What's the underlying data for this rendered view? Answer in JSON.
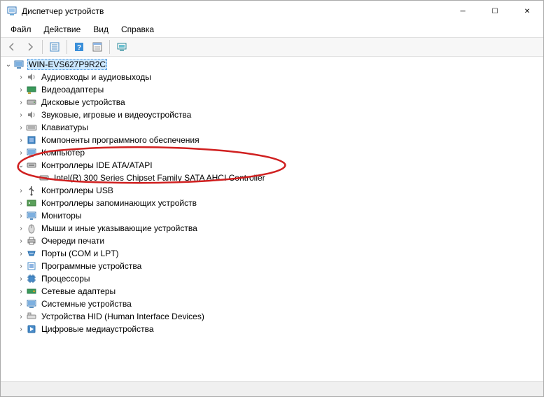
{
  "window": {
    "title": "Диспетчер устройств",
    "minimize": "─",
    "maximize": "☐",
    "close": "✕"
  },
  "menu": {
    "file": "Файл",
    "action": "Действие",
    "view": "Вид",
    "help": "Справка"
  },
  "tree": {
    "root": "WIN-EVS627P9R2C",
    "audio": "Аудиовходы и аудиовыходы",
    "video": "Видеоадаптеры",
    "disk": "Дисковые устройства",
    "sound_game": "Звуковые, игровые и видеоустройства",
    "keyboard": "Клавиатуры",
    "software_components": "Компоненты программного обеспечения",
    "computer": "Компьютер",
    "ide_ata": "Контроллеры IDE ATA/ATAPI",
    "ide_child": "Intel(R) 300 Series Chipset Family SATA AHCI Controller",
    "usb": "Контроллеры USB",
    "storage_ctrl": "Контроллеры запоминающих устройств",
    "monitors": "Мониторы",
    "mice": "Мыши и иные указывающие устройства",
    "print_queues": "Очереди печати",
    "ports": "Порты (COM и LPT)",
    "software_devices": "Программные устройства",
    "cpu": "Процессоры",
    "net": "Сетевые адаптеры",
    "system": "Системные устройства",
    "hid": "Устройства HID (Human Interface Devices)",
    "media": "Цифровые медиаустройства"
  }
}
